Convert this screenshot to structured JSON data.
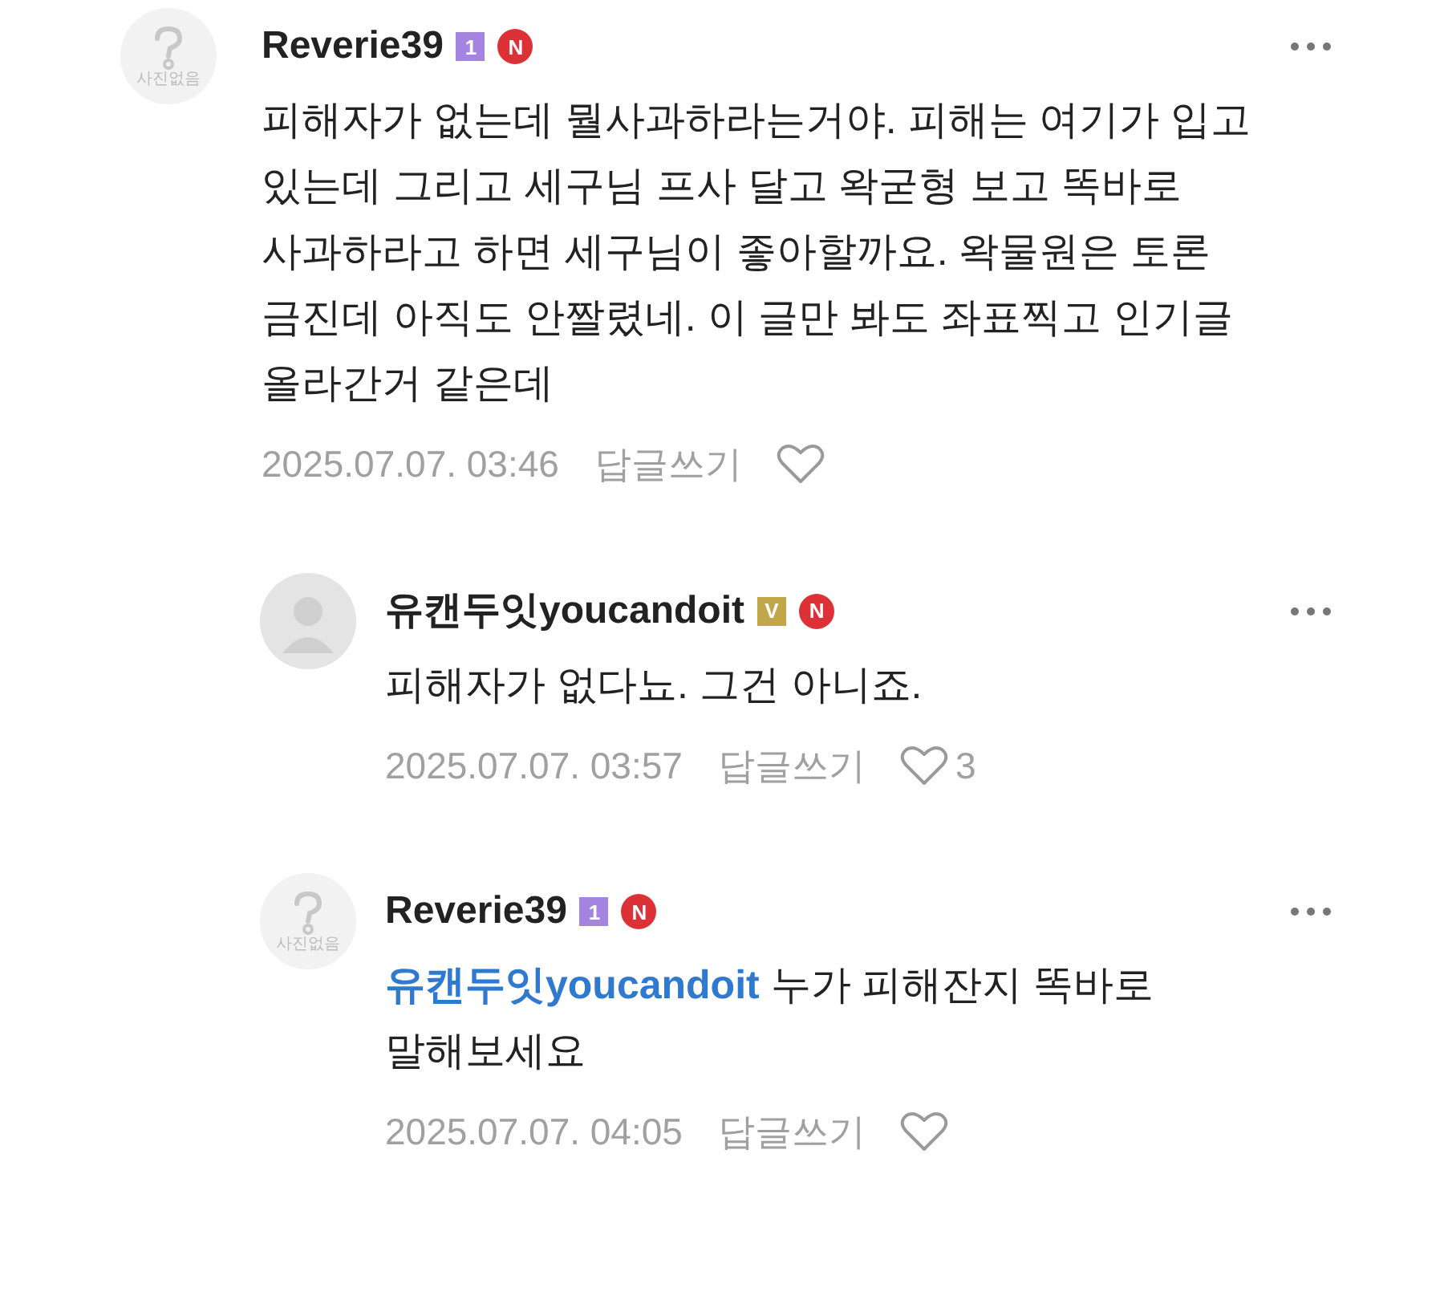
{
  "comments": [
    {
      "author": "Reverie39",
      "avatar": {
        "kind": "placeholder",
        "caption": "사진없음"
      },
      "badges": [
        {
          "kind": "square",
          "text": "1",
          "color": "#a584e0"
        },
        {
          "kind": "circle",
          "text": "N",
          "color": "#dd3138"
        }
      ],
      "body": "피해자가 없는데 뭘사과하라는거야. 피해는 여기가 입고 있는데 그리고 세구님 프사 달고 왁굳형 보고 똑바로 사과하라고 하면 세구님이 좋아할까요. 왁물원은 토론 금진데 아직도 안짤렸네. 이 글만 봐도 좌표찍고 인기글 올라간거 같은데",
      "date": "2025.07.07. 03:46",
      "reply_label": "답글쓰기",
      "replies": [
        {
          "author": "유캔두잇youcandoit",
          "avatar": {
            "kind": "silhouette"
          },
          "badges": [
            {
              "kind": "square",
              "text": "V",
              "color": "#c2a64a"
            },
            {
              "kind": "circle",
              "text": "N",
              "color": "#dd3138"
            }
          ],
          "body": "피해자가 없다뇨. 그건 아니죠.",
          "date": "2025.07.07. 03:57",
          "reply_label": "답글쓰기",
          "likes": "3"
        },
        {
          "author": "Reverie39",
          "avatar": {
            "kind": "placeholder",
            "caption": "사진없음"
          },
          "badges": [
            {
              "kind": "square",
              "text": "1",
              "color": "#a584e0"
            },
            {
              "kind": "circle",
              "text": "N",
              "color": "#dd3138"
            }
          ],
          "mention": "유캔두잇youcandoit",
          "body": "누가 피해잔지 똑바로 말해보세요",
          "date": "2025.07.07. 04:05",
          "reply_label": "답글쓰기"
        }
      ]
    }
  ]
}
